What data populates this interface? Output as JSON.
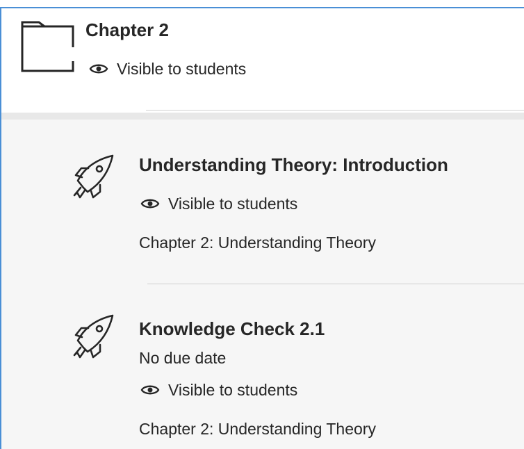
{
  "folder": {
    "title": "Chapter 2",
    "visibility": "Visible to students",
    "icon": "folder-icon"
  },
  "items": [
    {
      "title": "Understanding Theory: Introduction",
      "visibility": "Visible to students",
      "location": "Chapter 2: Understanding Theory",
      "icon": "rocket-icon"
    },
    {
      "title": "Knowledge Check 2.1",
      "due": "No due date",
      "visibility": "Visible to students",
      "location": "Chapter 2: Understanding Theory",
      "icon": "rocket-icon"
    }
  ],
  "colors": {
    "accent_border": "#4a8fd6",
    "text": "#262626",
    "panel_bg": "#f6f6f6"
  }
}
